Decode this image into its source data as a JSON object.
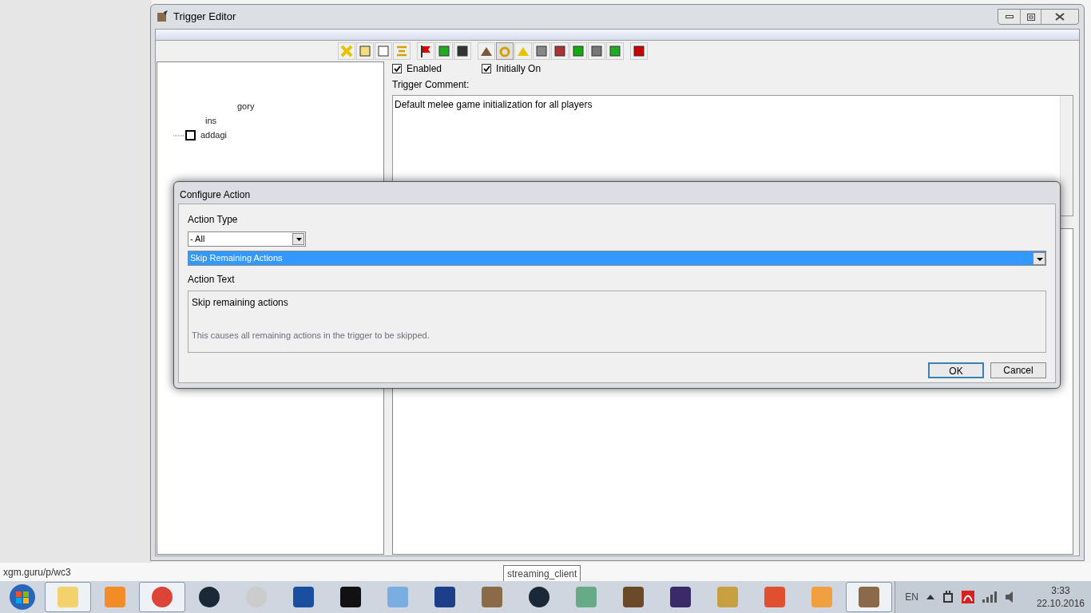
{
  "window": {
    "title": "Trigger Editor"
  },
  "tree": {
    "items": [
      {
        "label": "gory"
      },
      {
        "label": "ins"
      },
      {
        "label": "addagi"
      }
    ]
  },
  "trigger": {
    "enabled": {
      "label": "Enabled",
      "checked": true
    },
    "initially_on": {
      "label": "Initially On",
      "checked": true
    },
    "comment_label": "Trigger Comment:",
    "comment": "Default melee game initialization for all players"
  },
  "dialog": {
    "title": "Configure Action",
    "type_label": "Action Type",
    "type_value": "- All",
    "action_value": "Skip Remaining Actions",
    "text_label": "Action Text",
    "action_text": "Skip remaining actions",
    "description": "This causes all remaining actions in the trigger to be skipped.",
    "buttons": [
      "OK",
      "Cancel"
    ]
  },
  "browser": {
    "status_url": "xgm.guru/p/wc3",
    "tooltip": "streaming_client"
  },
  "taskbar": {
    "items": [
      {
        "selected": true
      },
      {
        "selected": false
      },
      {
        "selected": true
      },
      {
        "selected": false
      },
      {
        "selected": false
      },
      {
        "selected": false
      },
      {
        "selected": false
      },
      {
        "selected": false
      },
      {
        "selected": false
      },
      {
        "selected": false
      },
      {
        "selected": false
      },
      {
        "selected": false
      },
      {
        "selected": false
      },
      {
        "selected": false
      },
      {
        "selected": false
      },
      {
        "selected": false
      },
      {
        "selected": false
      },
      {
        "selected": true
      }
    ],
    "language": "EN",
    "time": "3:33",
    "date": "22.10.2016"
  }
}
